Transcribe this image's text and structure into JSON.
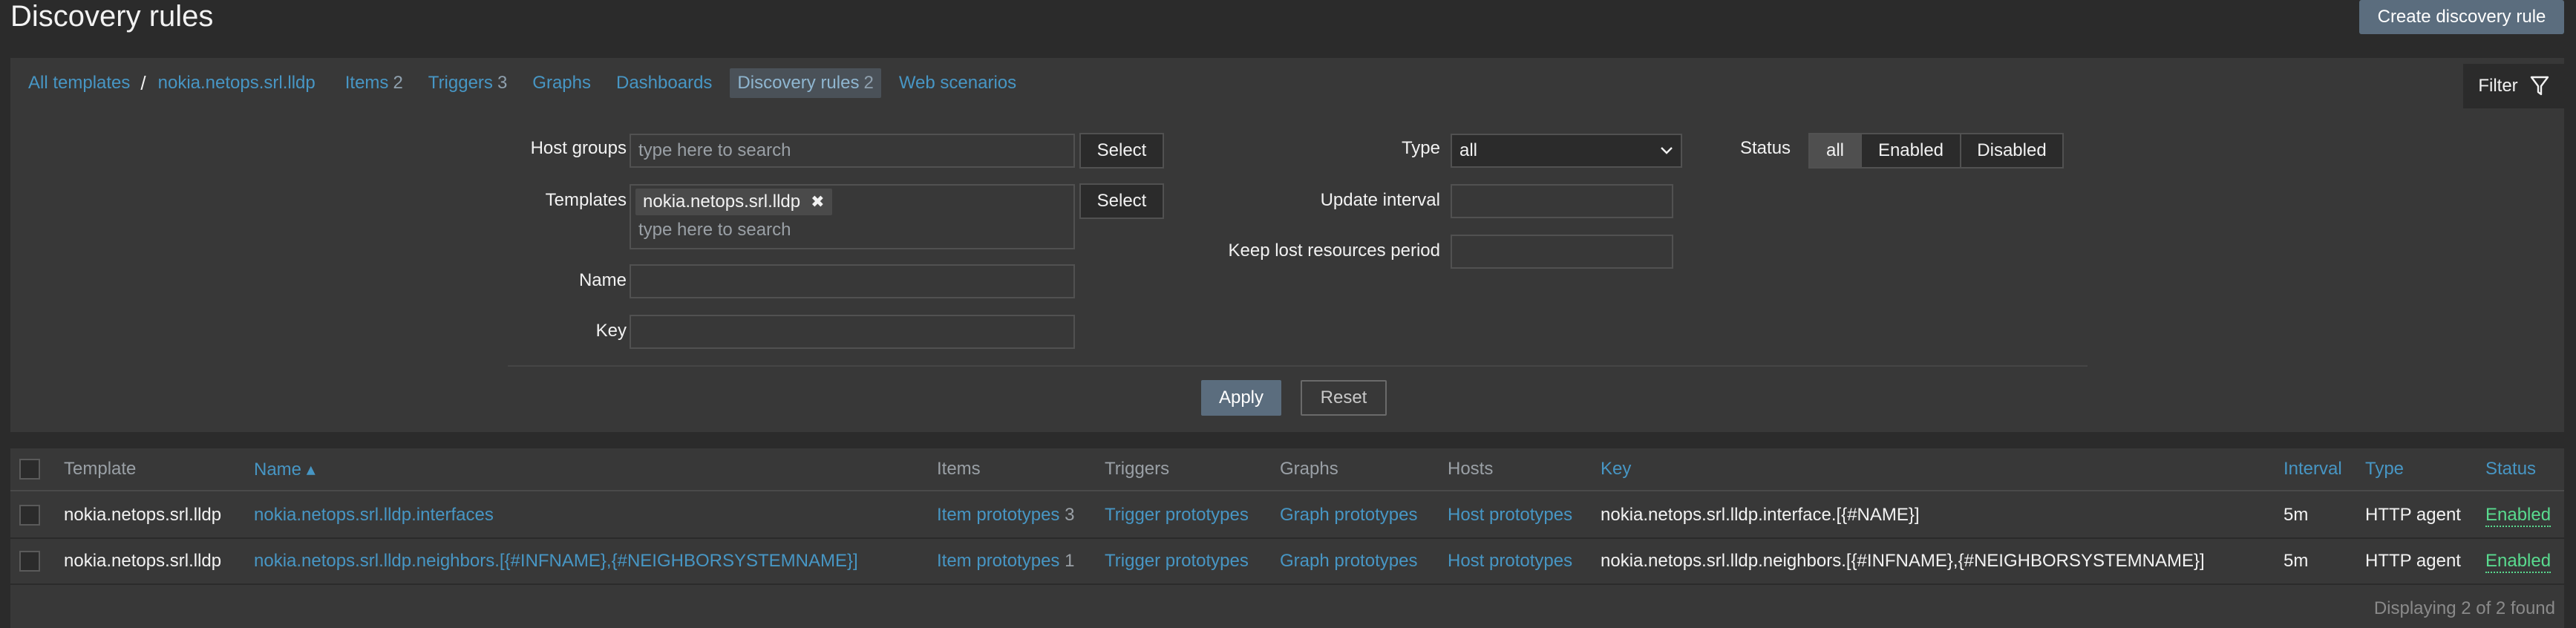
{
  "header": {
    "title": "Discovery rules",
    "create_button": "Create discovery rule"
  },
  "nav": {
    "breadcrumb_root": "All templates",
    "separator": "/",
    "template": "nokia.netops.srl.lldp",
    "items": {
      "label": "Items",
      "count": "2"
    },
    "triggers": {
      "label": "Triggers",
      "count": "3"
    },
    "graphs": "Graphs",
    "dashboards": "Dashboards",
    "discovery": {
      "label": "Discovery rules",
      "count": "2"
    },
    "web": "Web scenarios",
    "filter_label": "Filter"
  },
  "filter": {
    "host_groups_label": "Host groups",
    "host_groups_placeholder": "type here to search",
    "select_label": "Select",
    "templates_label": "Templates",
    "templates_tag": "nokia.netops.srl.lldp",
    "templates_placeholder": "type here to search",
    "name_label": "Name",
    "key_label": "Key",
    "type_label": "Type",
    "type_value": "all",
    "update_interval_label": "Update interval",
    "keep_lost_label": "Keep lost resources period",
    "status_label": "Status",
    "status_options": [
      "all",
      "Enabled",
      "Disabled"
    ],
    "apply": "Apply",
    "reset": "Reset"
  },
  "table": {
    "headers": {
      "template": "Template",
      "name": "Name ▴",
      "items": "Items",
      "triggers": "Triggers",
      "graphs": "Graphs",
      "hosts": "Hosts",
      "key": "Key",
      "interval": "Interval",
      "type": "Type",
      "status": "Status"
    },
    "rows": [
      {
        "template": "nokia.netops.srl.lldp",
        "name": "nokia.netops.srl.lldp.interfaces",
        "items": "Item prototypes",
        "items_count": "3",
        "triggers": "Trigger prototypes",
        "graphs": "Graph prototypes",
        "hosts": "Host prototypes",
        "key": "nokia.netops.srl.lldp.interface.[{#NAME}]",
        "interval": "5m",
        "type": "HTTP agent",
        "status": "Enabled"
      },
      {
        "template": "nokia.netops.srl.lldp",
        "name": "nokia.netops.srl.lldp.neighbors.[{#INFNAME},{#NEIGHBORSYSTEMNAME}]",
        "items": "Item prototypes",
        "items_count": "1",
        "triggers": "Trigger prototypes",
        "graphs": "Graph prototypes",
        "hosts": "Host prototypes",
        "key": "nokia.netops.srl.lldp.neighbors.[{#INFNAME},{#NEIGHBORSYSTEMNAME}]",
        "interval": "5m",
        "type": "HTTP agent",
        "status": "Enabled"
      }
    ],
    "footer": "Displaying 2 of 2 found"
  }
}
